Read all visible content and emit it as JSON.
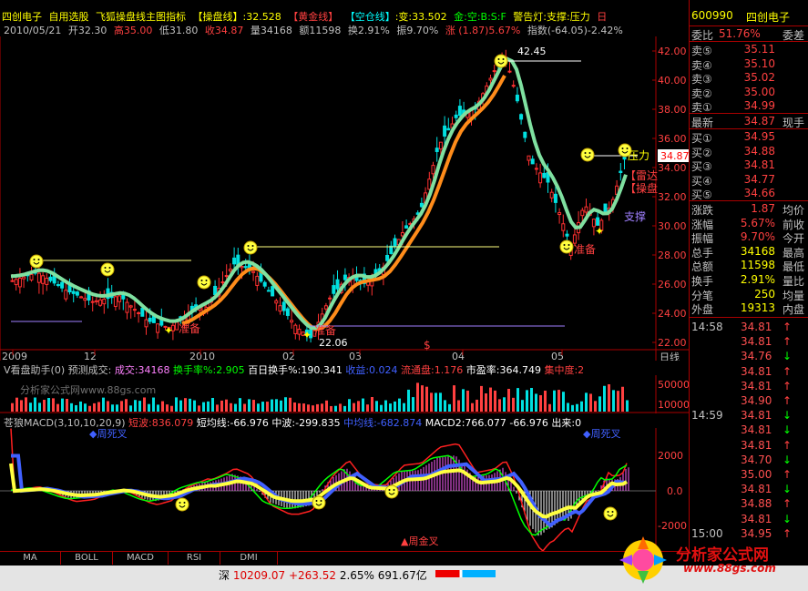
{
  "header": {
    "stock_name": "四创电子",
    "menu_select": "自用选股",
    "indicator_name": "飞狐操盘线主图指标",
    "operate_line_label": "【操盘线】",
    "operate_line_value": ":32.528",
    "gold_line_label": "【黄金线】",
    "empty_position_label": "【空仓线】",
    "change_label": ":变:33.502",
    "signal_text": "金:空:B:S:F",
    "alarm_text": "警告灯:支撑:压力",
    "flag_text": "日"
  },
  "quote_row": {
    "date": "2010/05/21",
    "open": "开32.30",
    "high": "高35.00",
    "low": "低31.80",
    "close": "收34.87",
    "volume": "量34168",
    "amount": "额11598",
    "turnover": "换2.91%",
    "amplitude": "振9.70%",
    "rise": "涨 (1.87)5.67%",
    "index": "指数(-64.05)-2.42%"
  },
  "main_chart": {
    "y_ticks": [
      "42.00",
      "40.00",
      "38.00",
      "36.00",
      "34.00",
      "32.00",
      "30.00",
      "28.00",
      "26.00",
      "24.00",
      "22.00"
    ],
    "x_ticks": [
      "2009",
      "12",
      "2010",
      "02",
      "03",
      "04",
      "05"
    ],
    "annotations": {
      "high_label": "42.45",
      "low_label": "22.06",
      "pressure_label": "压力",
      "support_label": "支撑",
      "prepare_label_1": "准备",
      "prepare_label_2": "准备",
      "prepare_label_3": "准备",
      "danger_label": "【雷达",
      "operate_label": "【操盘",
      "current_price_tag": "34.87",
      "period_label": "日线",
      "dollar_mark": "$"
    }
  },
  "chart_data": [
    {
      "type": "line",
      "title": "飞狐操盘线主图指标",
      "x": [
        "2009",
        "12",
        "2010",
        "02",
        "03",
        "04",
        "05"
      ],
      "series": [
        {
          "name": "【操盘线】",
          "values": [
            26.5,
            25.5,
            24.5,
            23.8,
            28.5,
            36.5,
            32.5
          ]
        }
      ],
      "ylim": [
        21.5,
        43.0
      ]
    },
    {
      "type": "bar",
      "title": "V看盘助手(0)",
      "values_label": "成交:34168",
      "ylim": [
        0,
        50000
      ]
    }
  ],
  "volume_panel": {
    "title": "V看盘助手(0)",
    "forecast": "预测成交:",
    "deal": "成交:34168",
    "turnover_label": "换手率%:2.905",
    "hundred_turnover": "百日换手%:190.341",
    "income": "收益:0.024",
    "circulating": "流通盘:1.176",
    "pe": "市盈率:364.749",
    "concentration": "集中度:2",
    "y_ticks": [
      "50000",
      "10000"
    ],
    "watermark": "分析家公式网www.88gs.com"
  },
  "macd_panel": {
    "title": "苍狼MACD(3,10,10,20,9)",
    "short_wave": "短波:836.079",
    "short_avg": "短均线:-66.976",
    "mid_wave": "中波:-299.835",
    "mid_avg": "中均线:-682.874",
    "macd2": "MACD2:766.077",
    "macd2_b": "-66.976",
    "out_label": "出来:0",
    "dead_cross": "周死叉",
    "dead_cross_2": "周死叉",
    "gold_cross": "周金叉",
    "y_ticks": [
      "2000",
      "0.0",
      "-2000"
    ]
  },
  "right_panel": {
    "code": "600990",
    "name": "四创电子",
    "ratio_label": "委比",
    "ratio_val": "51.76%",
    "ratio_diff_label": "委差",
    "asks": [
      {
        "label": "卖⑤",
        "price": "35.11"
      },
      {
        "label": "卖④",
        "price": "35.10"
      },
      {
        "label": "卖③",
        "price": "35.02"
      },
      {
        "label": "卖②",
        "price": "35.00"
      },
      {
        "label": "卖①",
        "price": "34.99"
      }
    ],
    "last_label": "最新",
    "last_val": "34.87",
    "last_vol_label": "现手",
    "bids": [
      {
        "label": "买①",
        "price": "34.95"
      },
      {
        "label": "买②",
        "price": "34.88"
      },
      {
        "label": "买③",
        "price": "34.81"
      },
      {
        "label": "买④",
        "price": "34.77"
      },
      {
        "label": "买⑤",
        "price": "34.66"
      }
    ],
    "stats": [
      {
        "label": "涨跌",
        "val": "1.87",
        "ex": "均价"
      },
      {
        "label": "涨幅",
        "val": "5.67%",
        "ex": "前收"
      },
      {
        "label": "振幅",
        "val": "9.70%",
        "ex": "今开"
      },
      {
        "label": "总手",
        "val": "34168",
        "ex": "最高"
      },
      {
        "label": "总额",
        "val": "11598",
        "ex": "最低"
      },
      {
        "label": "换手",
        "val": "2.91%",
        "ex": "量比"
      },
      {
        "label": "分笔",
        "val": "250",
        "ex": "均量"
      },
      {
        "label": "外盘",
        "val": "19313",
        "ex": "内盘"
      }
    ],
    "ticks": [
      {
        "time": "14:58",
        "price": "34.81",
        "arrow": "↑"
      },
      {
        "time": "",
        "price": "34.81",
        "arrow": "↑"
      },
      {
        "time": "",
        "price": "34.76",
        "arrow": "↓"
      },
      {
        "time": "",
        "price": "34.81",
        "arrow": "↑"
      },
      {
        "time": "",
        "price": "34.81",
        "arrow": "↑"
      },
      {
        "time": "",
        "price": "34.90",
        "arrow": "↑"
      },
      {
        "time": "14:59",
        "price": "34.81",
        "arrow": "↓"
      },
      {
        "time": "",
        "price": "34.81",
        "arrow": "↓"
      },
      {
        "time": "",
        "price": "34.81",
        "arrow": "↑"
      },
      {
        "time": "",
        "price": "34.70",
        "arrow": "↓"
      },
      {
        "time": "",
        "price": "35.00",
        "arrow": "↑"
      },
      {
        "time": "",
        "price": "34.81",
        "arrow": "↓"
      },
      {
        "time": "",
        "price": "34.88",
        "arrow": "↑"
      },
      {
        "time": "",
        "price": "34.81",
        "arrow": "↓"
      },
      {
        "time": "15:00",
        "price": "34.95",
        "arrow": "↑"
      }
    ]
  },
  "tabs": [
    "MA",
    "BOLL",
    "MACD",
    "RSI",
    "DMI"
  ],
  "status_bar": {
    "market": "深",
    "index": "10209.07",
    "change": "+263.52",
    "pct": "2.65%",
    "amount": "691.67亿",
    "logo_text": "分析家公式网",
    "logo_url": "www.88gs.com"
  }
}
